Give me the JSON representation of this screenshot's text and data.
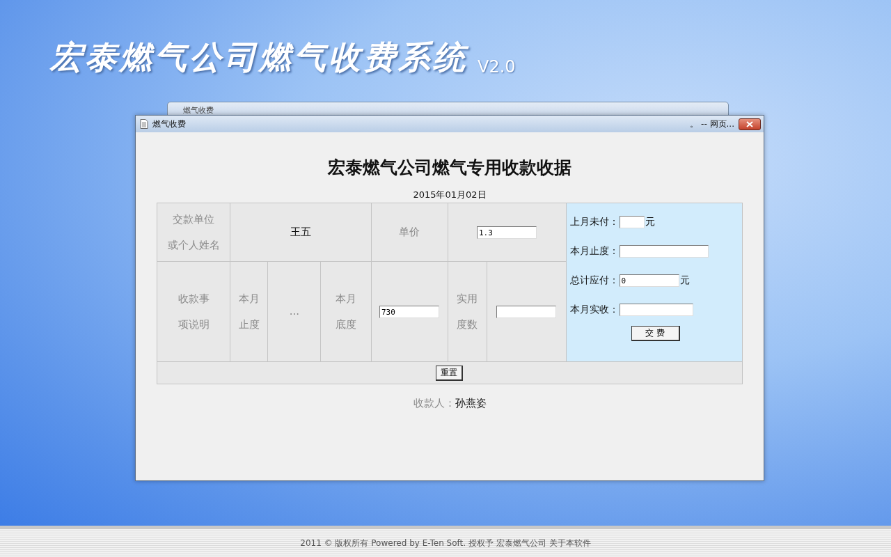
{
  "app": {
    "title": "宏泰燃气公司燃气收费系统",
    "version": "V2.0"
  },
  "background_window": {
    "title": "燃气收费"
  },
  "dialog": {
    "title": "燃气收费",
    "title_suffix": "。 -- 网页...",
    "heading": "宏泰燃气公司燃气专用收款收据",
    "date": "2015年01月02日",
    "payer_label_lines": [
      "交款单位",
      "或个人姓名"
    ],
    "payer_name": "王五",
    "unit_price_label": "单价",
    "unit_price_value": "1.3",
    "item_label_lines": [
      "收款事",
      "项说明"
    ],
    "current_reading_label_lines": [
      "本月",
      "止度"
    ],
    "ellipsis": "...",
    "base_reading_label_lines": [
      "本月",
      "底度"
    ],
    "base_reading_value": "730",
    "usage_label_lines": [
      "实用",
      "度数"
    ],
    "summary_fields": [
      {
        "label": "上月未付：",
        "unit": "元"
      },
      {
        "label": "本月止度："
      },
      {
        "label": "总计应付：",
        "value": "0",
        "unit": "元"
      },
      {
        "label": "本月实收："
      }
    ],
    "pay_button": "交 费",
    "reset_button": "重置",
    "payee_label": "收款人：",
    "payee_name": "孙燕姿"
  },
  "footer": {
    "text": "2011 © 版权所有  Powered by E-Ten Soft. 授权予 宏泰燃气公司",
    "link": "关于本软件"
  }
}
